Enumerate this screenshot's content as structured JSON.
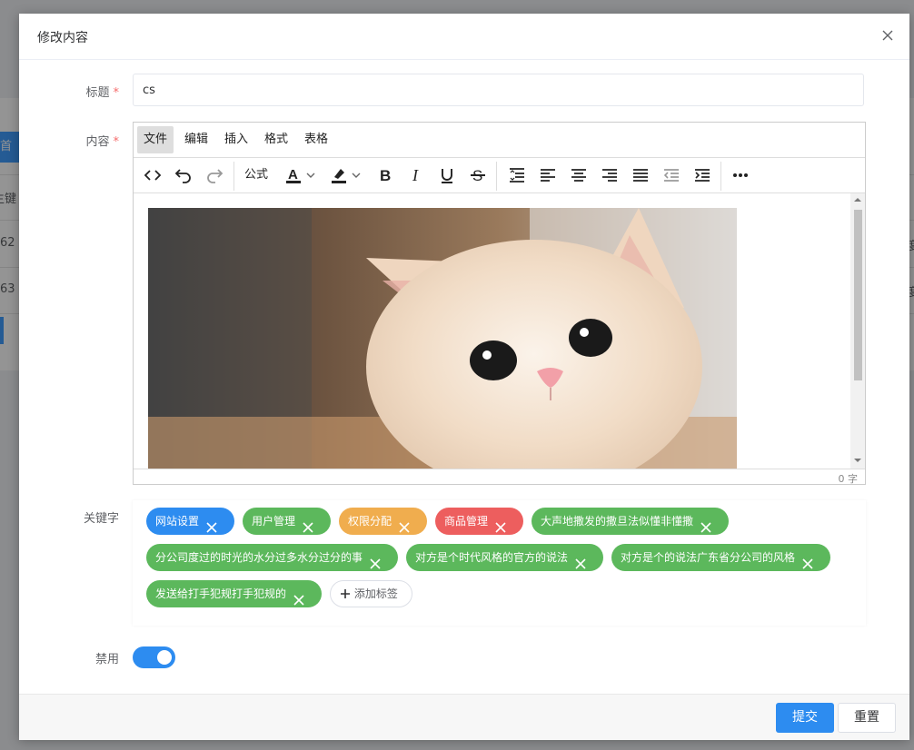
{
  "background": {
    "side_tab_label": "首",
    "row_labels": [
      "主键",
      "62",
      "63"
    ],
    "right_labels": [
      "度",
      "度"
    ]
  },
  "dialog": {
    "title": "修改内容",
    "close_icon": "close-icon"
  },
  "form": {
    "title_label": "标题",
    "title_value": "cs",
    "content_label": "内容",
    "keywords_label": "关键字",
    "disable_label": "禁用",
    "required_mark": "*",
    "disable_switch_on": true
  },
  "editor": {
    "menus": [
      "文件",
      "编辑",
      "插入",
      "格式",
      "表格"
    ],
    "active_menu": "文件",
    "toolbar": {
      "formula_label": "公式",
      "buttons": [
        "code-icon",
        "undo-icon",
        "redo-icon",
        "font-color-icon",
        "highlight-icon",
        "bold-icon",
        "italic-icon",
        "underline-icon",
        "strikethrough-icon",
        "line-height-icon",
        "align-left-icon",
        "align-center-icon",
        "align-right-icon",
        "align-justify-icon",
        "outdent-icon",
        "indent-icon",
        "more-icon"
      ]
    },
    "image_alt": "kitten photo",
    "word_count": "0 字"
  },
  "tags": {
    "items": [
      {
        "label": "网站设置",
        "color": "#2d8cf0"
      },
      {
        "label": "用户管理",
        "color": "#5cb85c"
      },
      {
        "label": "权限分配",
        "color": "#f0ad4e"
      },
      {
        "label": "商品管理",
        "color": "#ed5e5e"
      },
      {
        "label": "大声地撒发的撒旦法似懂非懂撒",
        "color": "#5cb85c"
      },
      {
        "label": "分公司度过的时光的水分过多水分过分的事",
        "color": "#5cb85c"
      },
      {
        "label": "对方是个时代风格的官方的说法",
        "color": "#5cb85c"
      },
      {
        "label": "对方是个的说法广东省分公司的风格",
        "color": "#5cb85c"
      },
      {
        "label": "发送给打手犯规打手犯规的",
        "color": "#5cb85c"
      }
    ],
    "add_label": "添加标签"
  },
  "footer": {
    "submit_label": "提交",
    "reset_label": "重置"
  }
}
